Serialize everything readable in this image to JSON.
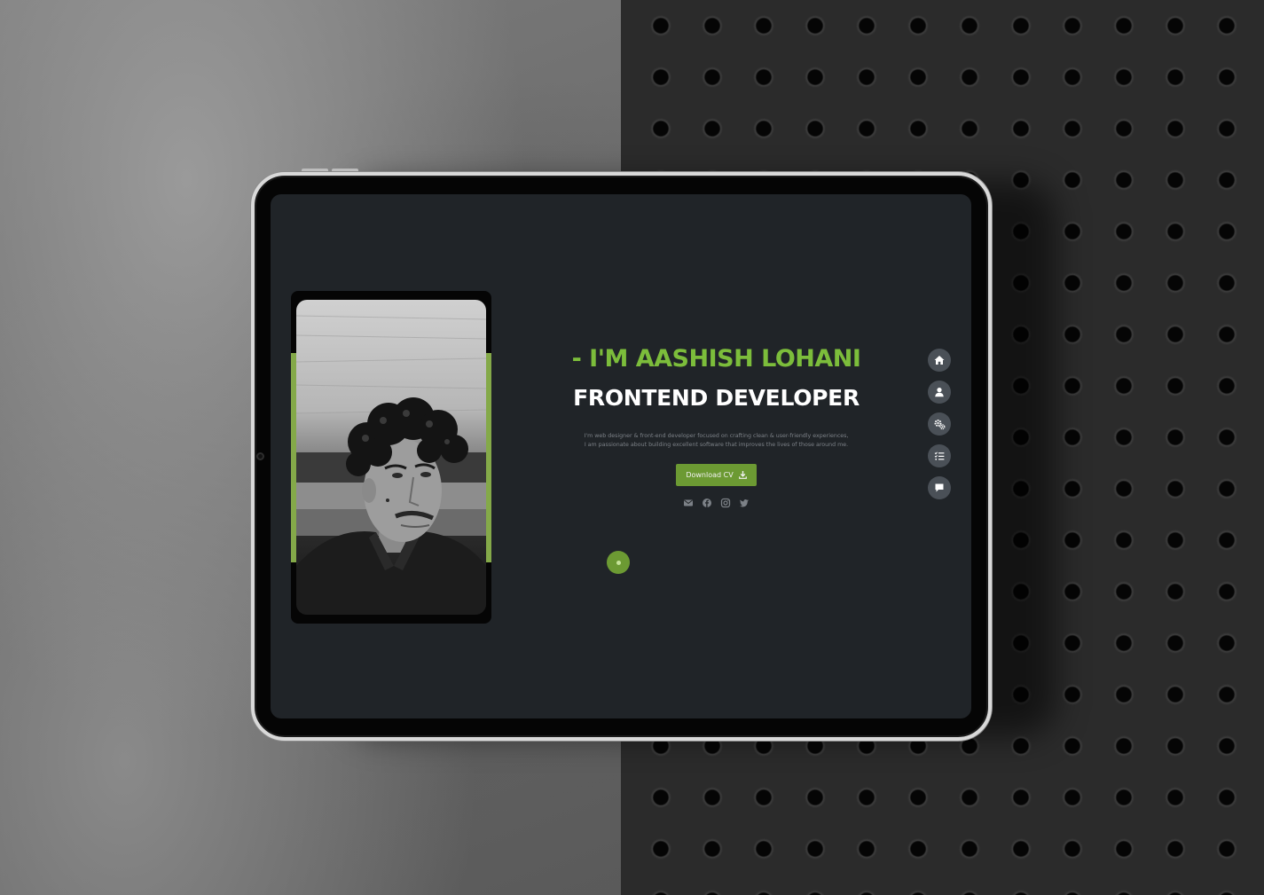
{
  "theme": {
    "accent": "#7cbd3b",
    "button_green": "#6c9a33",
    "screen_bg": "#202428",
    "nav_bg": "#4a5057"
  },
  "hero": {
    "name": "- I'M AASHISH LOHANI",
    "role": "FRONTEND DEVELOPER",
    "description": "I'm web designer & front-end developer focused on crafting clean & user-friendly experiences, I am passionate about building excellent software that improves the lives of those around me.",
    "cv_button": "Download CV"
  },
  "socials": [
    {
      "icon": "envelope-icon"
    },
    {
      "icon": "facebook-icon"
    },
    {
      "icon": "instagram-icon"
    },
    {
      "icon": "twitter-icon"
    }
  ],
  "side_nav": [
    {
      "icon": "home-icon"
    },
    {
      "icon": "user-icon"
    },
    {
      "icon": "gears-icon"
    },
    {
      "icon": "list-check-icon"
    },
    {
      "icon": "comment-icon"
    }
  ],
  "photo": {
    "subject": "profile-photo"
  }
}
